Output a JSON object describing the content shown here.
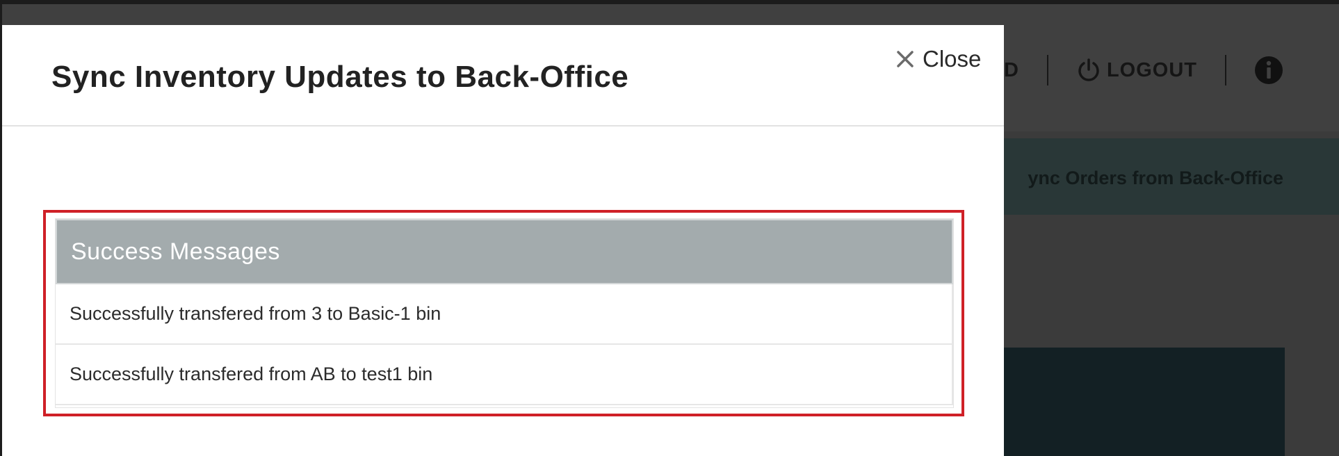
{
  "background": {
    "nav": {
      "partial_item_label": "D",
      "logout_label": "LOGOUT"
    },
    "band_label": "ync Orders from Back-Office"
  },
  "modal": {
    "title": "Sync Inventory Updates to Back-Office",
    "close_label": "Close",
    "panel": {
      "heading": "Success Messages",
      "messages": [
        "Successfully transfered from 3 to Basic-1 bin",
        "Successfully transfered from AB to test1 bin"
      ]
    }
  },
  "colors": {
    "overlay_dark": "#3b3b3b",
    "panel_heading": "#a3abad",
    "highlight_border": "#cf2027",
    "modal_background": "#ffffff"
  }
}
